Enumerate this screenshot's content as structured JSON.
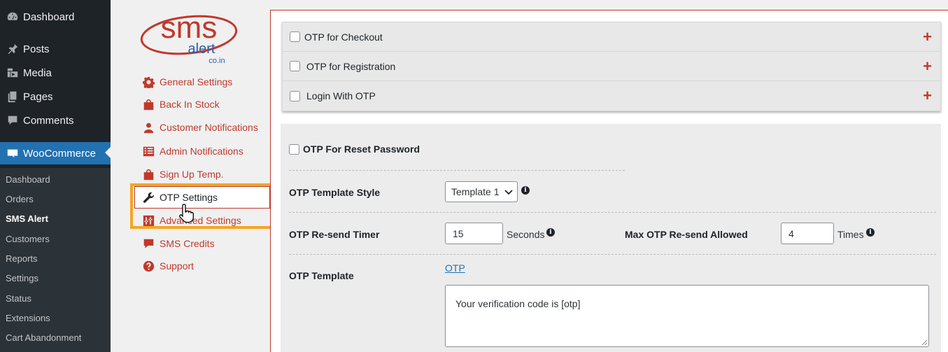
{
  "wp_menu": {
    "items": [
      {
        "label": "Dashboard",
        "icon": "dashboard-icon"
      },
      {
        "label": "Posts",
        "icon": "pin-icon"
      },
      {
        "label": "Media",
        "icon": "media-icon"
      },
      {
        "label": "Pages",
        "icon": "pages-icon"
      },
      {
        "label": "Comments",
        "icon": "comment-icon"
      },
      {
        "label": "WooCommerce",
        "icon": "woo-icon"
      }
    ],
    "submenu": [
      "Dashboard",
      "Orders",
      "SMS Alert",
      "Customers",
      "Reports",
      "Settings",
      "Status",
      "Extensions",
      "Cart Abandonment"
    ],
    "current_submenu": "SMS Alert"
  },
  "plugin": {
    "logo_main": "sms",
    "logo_sub": "alert",
    "logo_domain": "co.in",
    "nav": [
      {
        "label": "General Settings",
        "icon": "gear-icon"
      },
      {
        "label": "Back In Stock",
        "icon": "bag-icon"
      },
      {
        "label": "Customer Notifications",
        "icon": "user-icon"
      },
      {
        "label": "Admin Notifications",
        "icon": "list-icon"
      },
      {
        "label": "Sign Up Temp.",
        "icon": "bag-icon"
      },
      {
        "label": "OTP Settings",
        "icon": "wrench-icon"
      },
      {
        "label": "Advanced Settings",
        "icon": "sliders-icon"
      },
      {
        "label": "SMS Credits",
        "icon": "comment-icon"
      },
      {
        "label": "Support",
        "icon": "question-icon"
      }
    ],
    "active_nav": "OTP Settings"
  },
  "accordion": [
    {
      "label": "OTP for Checkout"
    },
    {
      "label": "OTP for Registration"
    },
    {
      "label": "Login With OTP"
    }
  ],
  "settings": {
    "reset_password_label": "OTP For Reset Password",
    "template_style_label": "OTP Template Style",
    "template_style_value": "Template 1",
    "resend_timer_label": "OTP Re-send Timer",
    "resend_timer_value": "15",
    "resend_timer_unit": "Seconds",
    "max_resend_label": "Max OTP Re-send Allowed",
    "max_resend_value": "4",
    "max_resend_unit": "Times",
    "otp_template_label": "OTP Template",
    "otp_token_link": "OTP",
    "otp_template_value": "Your verification code is [otp]"
  },
  "colors": {
    "brand": "#c0392b",
    "wp_sidebar": "#1d2327",
    "wp_active": "#2271b1",
    "highlight": "#f5a623"
  }
}
